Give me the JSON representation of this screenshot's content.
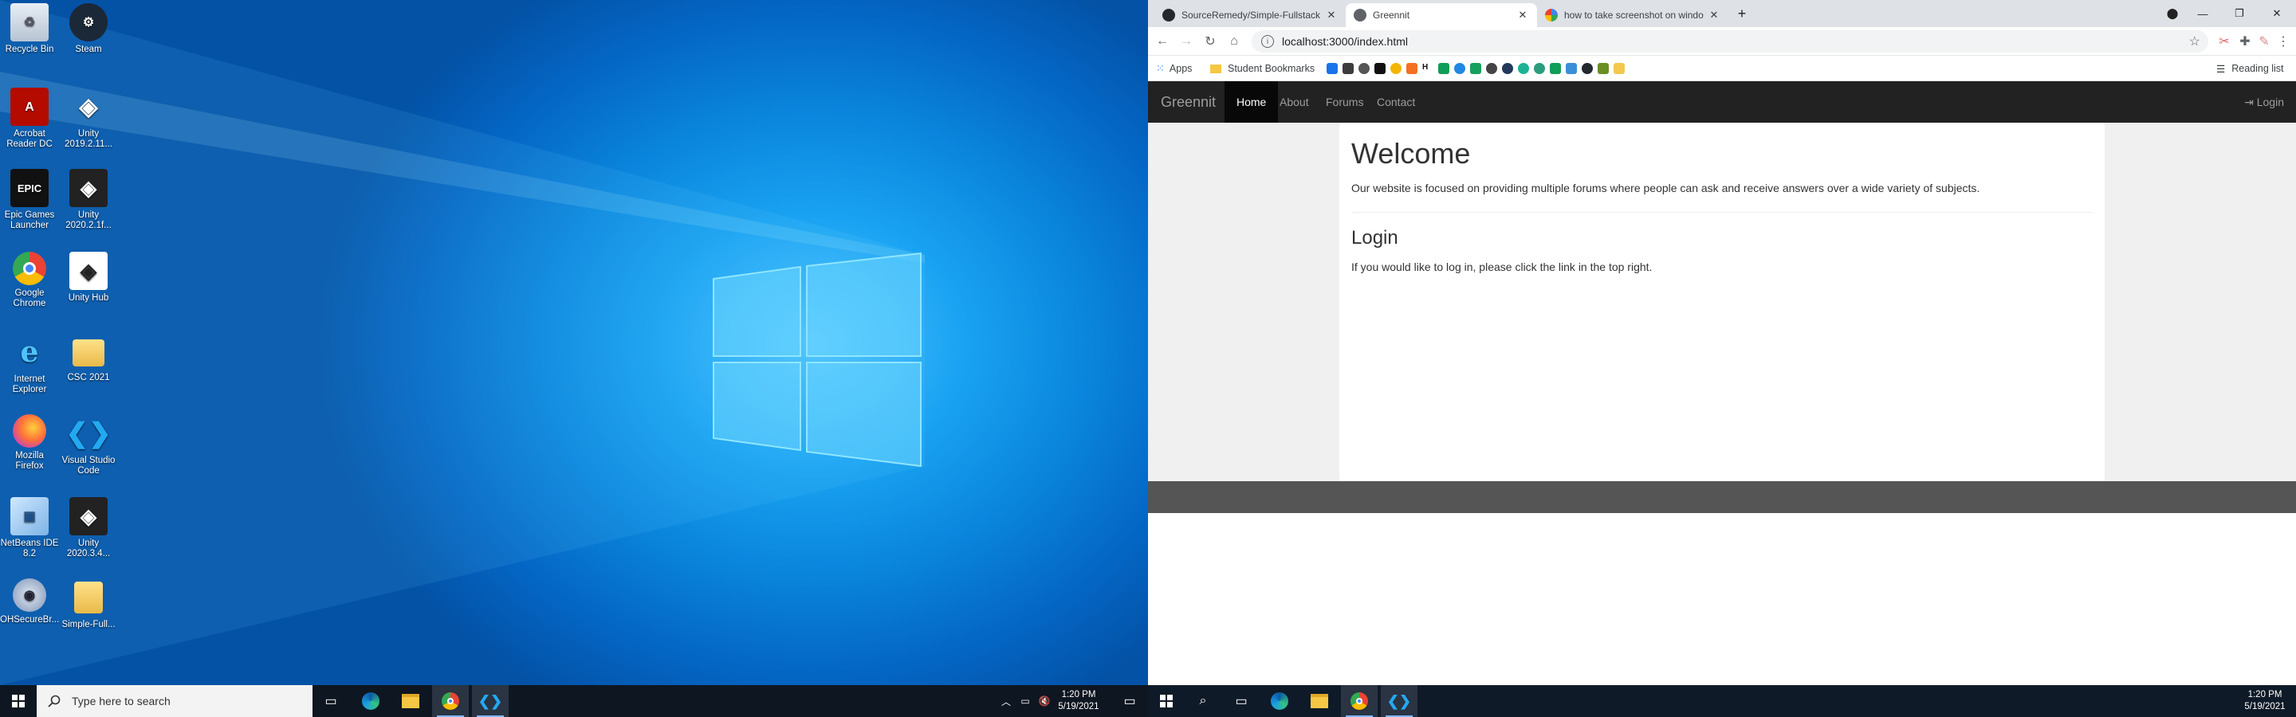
{
  "desktop": {
    "icons": [
      {
        "label": "Recycle Bin",
        "icon": "recycle-bin-icon"
      },
      {
        "label": "Steam",
        "icon": "steam-icon"
      },
      {
        "label": "Acrobat Reader DC",
        "icon": "acrobat-icon"
      },
      {
        "label": "Unity 2019.2.11...",
        "icon": "unity-icon"
      },
      {
        "label": "Epic Games Launcher",
        "icon": "epic-games-icon"
      },
      {
        "label": "Unity 2020.2.1f...",
        "icon": "unity-icon"
      },
      {
        "label": "Google Chrome",
        "icon": "chrome-icon"
      },
      {
        "label": "Unity Hub",
        "icon": "unity-hub-icon"
      },
      {
        "label": "Internet Explorer",
        "icon": "internet-explorer-icon"
      },
      {
        "label": "CSC 2021",
        "icon": "folder-icon"
      },
      {
        "label": "Mozilla Firefox",
        "icon": "firefox-icon"
      },
      {
        "label": "Visual Studio Code",
        "icon": "vscode-icon"
      },
      {
        "label": "NetBeans IDE 8.2",
        "icon": "netbeans-icon"
      },
      {
        "label": "Unity 2020.3.4...",
        "icon": "unity-icon"
      },
      {
        "label": "OHSecureBr...",
        "icon": "secure-browser-icon"
      },
      {
        "label": "Simple-Full...",
        "icon": "folder-icon"
      }
    ]
  },
  "left_taskbar": {
    "search_placeholder": "Type here to search",
    "time": "1:20 PM",
    "date": "5/19/2021"
  },
  "right_taskbar": {
    "time": "1:20 PM",
    "date": "5/19/2021"
  },
  "browser": {
    "tabs": [
      {
        "title": "SourceRemedy/Simple-Fullstack",
        "active": false
      },
      {
        "title": "Greennit",
        "active": true
      },
      {
        "title": "how to take screenshot on windo",
        "active": false
      }
    ],
    "address": "localhost:3000/index.html",
    "bookmarks": {
      "apps": "Apps",
      "student": "Student Bookmarks",
      "reading_list": "Reading list"
    }
  },
  "site": {
    "brand": "Greennit",
    "nav": [
      "Home",
      "About",
      "Forums",
      "Contact"
    ],
    "login": "Login",
    "welcome_title": "Welcome",
    "welcome_text": "Our website is focused on providing multiple forums where people can ask and receive answers over a wide variety of subjects.",
    "login_title": "Login",
    "login_text": "If you would like to log in, please click the link in the top right."
  },
  "colors": {
    "navbar": "#222222",
    "footer": "#555555",
    "desktop_blue": "#0a86dd"
  }
}
